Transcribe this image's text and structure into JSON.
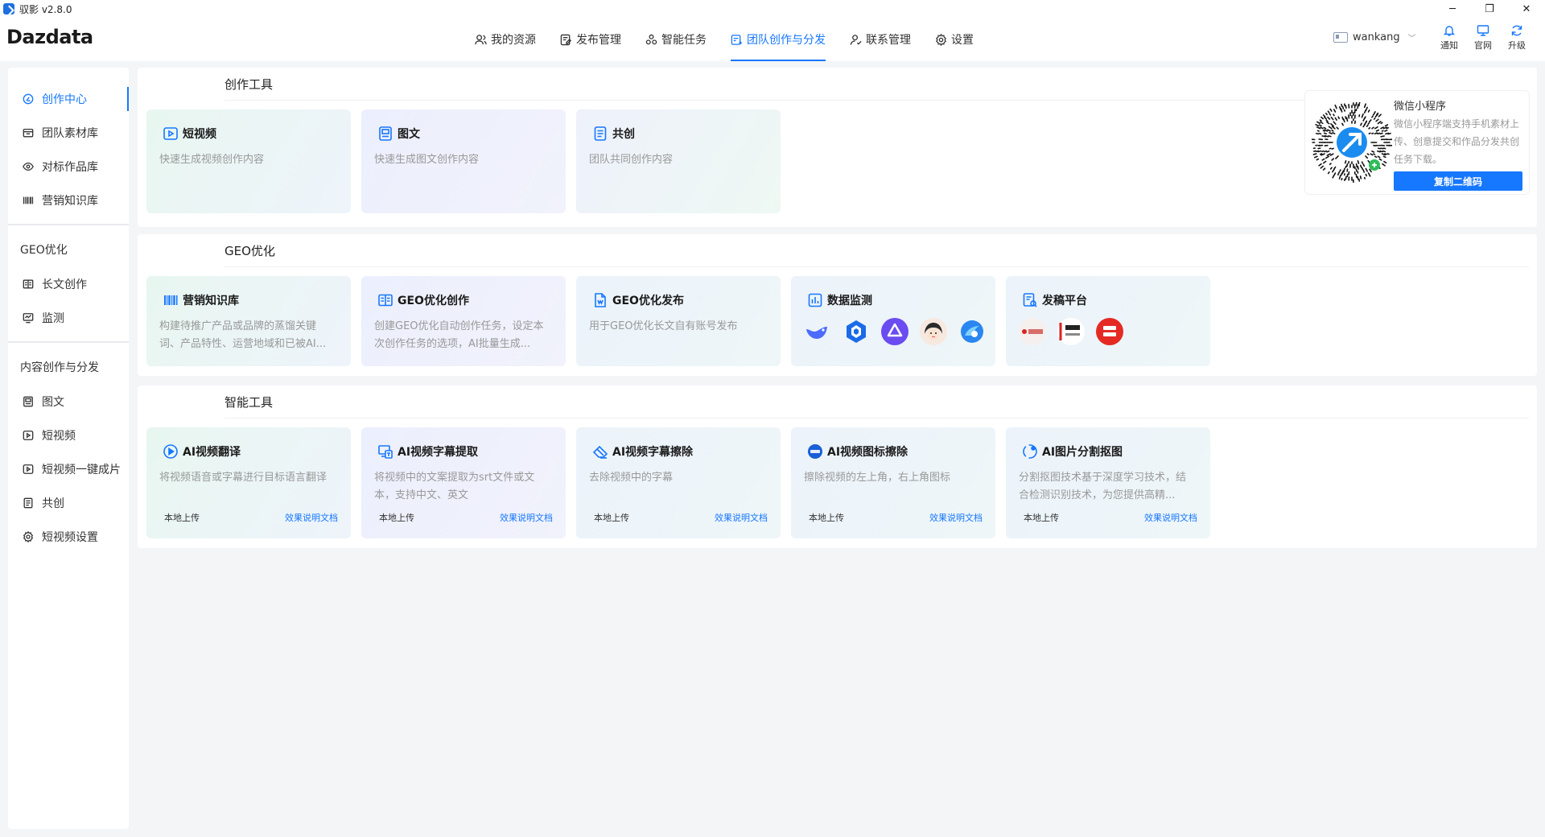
{
  "window": {
    "title": "驭影 v2.8.0",
    "minimize": "─",
    "maximize": "❐",
    "close": "✕"
  },
  "header": {
    "logo": "Dazdata",
    "nav": [
      {
        "label": "我的资源",
        "icon": "users-icon"
      },
      {
        "label": "发布管理",
        "icon": "publish-icon"
      },
      {
        "label": "智能任务",
        "icon": "task-icon"
      },
      {
        "label": "团队创作与分发",
        "icon": "team-create-icon",
        "active": true
      },
      {
        "label": "联系管理",
        "icon": "contact-icon"
      },
      {
        "label": "设置",
        "icon": "gear-icon"
      }
    ],
    "username": "wankang",
    "actions": [
      {
        "label": "通知",
        "icon": "bell-icon"
      },
      {
        "label": "官网",
        "icon": "monitor-icon"
      },
      {
        "label": "升级",
        "icon": "refresh-icon"
      }
    ],
    "accent": "#1677ff"
  },
  "sidebar": {
    "items_top": [
      {
        "label": "创作中心",
        "icon": "create-center-icon",
        "active": true
      },
      {
        "label": "团队素材库",
        "icon": "folder-icon"
      },
      {
        "label": "对标作品库",
        "icon": "eye-icon"
      },
      {
        "label": "营销知识库",
        "icon": "barcode-icon"
      }
    ],
    "group_geo": "GEO优化",
    "items_geo": [
      {
        "label": "长文创作",
        "icon": "book-icon"
      },
      {
        "label": "监测",
        "icon": "monitor-chart-icon"
      }
    ],
    "group_content": "内容创作与分发",
    "items_content": [
      {
        "label": "图文",
        "icon": "image-text-icon"
      },
      {
        "label": "短视频",
        "icon": "video-icon"
      },
      {
        "label": "短视频一键成片",
        "icon": "video-quick-icon"
      },
      {
        "label": "共创",
        "icon": "doc-icon"
      },
      {
        "label": "短视频设置",
        "icon": "gear-icon"
      }
    ]
  },
  "sections": {
    "creation_tools": {
      "title": "创作工具",
      "cards": [
        {
          "title": "短视频",
          "desc": "快速生成视频创作内容",
          "icon": "video-icon"
        },
        {
          "title": "图文",
          "desc": "快速生成图文创作内容",
          "icon": "image-text-icon"
        },
        {
          "title": "共创",
          "desc": "团队共同创作内容",
          "icon": "doc-icon"
        }
      ]
    },
    "miniprogram": {
      "title": "微信小程序",
      "desc": "微信小程序端支持手机素材上传、创意提交和作品分发共创任务下载。",
      "button": "复制二维码"
    },
    "geo": {
      "title": "GEO优化",
      "cards": [
        {
          "title": "营销知识库",
          "desc": "构建待推广产品或品牌的蒸馏关键词、产品特性、运营地域和已被AI...",
          "icon": "barcode-icon"
        },
        {
          "title": "GEO优化创作",
          "desc": "创建GEO优化自动创作任务，设定本次创作任务的选项，AI批量生成...",
          "icon": "book-icon"
        },
        {
          "title": "GEO优化发布",
          "desc": "用于GEO优化长文自有账号发布",
          "icon": "publish-doc-icon"
        },
        {
          "title": "数据监测",
          "icon": "data-monitor-icon",
          "logos": [
            "deepseek-logo",
            "doubao-logo",
            "kimi-logo",
            "yuanbao-avatar-logo",
            "wenxin-logo"
          ]
        },
        {
          "title": "发稿平台",
          "icon": "platform-icon",
          "logos": [
            "press-logo",
            "media-logo",
            "china-box-logo"
          ]
        }
      ]
    },
    "ai_tools": {
      "title": "智能工具",
      "cards": [
        {
          "title": "AI视频翻译",
          "desc": "将视频语音或字幕进行目标语言翻译",
          "icon": "video-translate-icon",
          "foot_left": "本地上传",
          "foot_right": "效果说明文档"
        },
        {
          "title": "AI视频字幕提取",
          "desc": "将视频中的文案提取为srt文件或文本，支持中文、英文",
          "icon": "subtitle-extract-icon",
          "foot_left": "本地上传",
          "foot_right": "效果说明文档"
        },
        {
          "title": "AI视频字幕擦除",
          "desc": "去除视频中的字幕",
          "icon": "eraser-icon",
          "foot_left": "本地上传",
          "foot_right": "效果说明文档"
        },
        {
          "title": "AI视频图标擦除",
          "desc": "擦除视频的左上角，右上角图标",
          "icon": "logo-erase-icon",
          "foot_left": "本地上传",
          "foot_right": "效果说明文档"
        },
        {
          "title": "AI图片分割抠图",
          "desc": "分割抠图技术基于深度学习技术，结合检测识别技术，为您提供高精...",
          "icon": "cutout-icon",
          "foot_left": "本地上传",
          "foot_right": "效果说明文档"
        }
      ]
    }
  }
}
